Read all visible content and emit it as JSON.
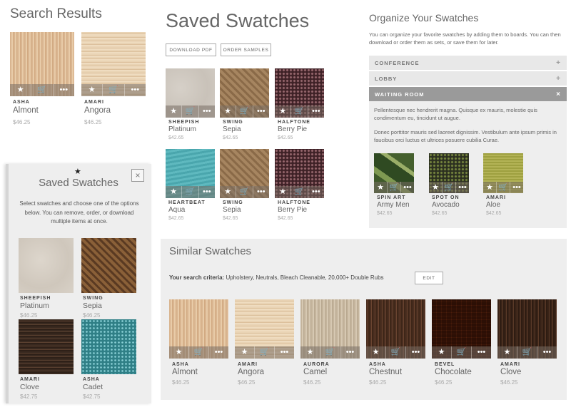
{
  "search_results": {
    "title": "Search Results",
    "items": [
      {
        "brand": "ASHA",
        "name": "Almont",
        "price": "$46.25"
      },
      {
        "brand": "AMARI",
        "name": "Angora",
        "price": "$46.25"
      }
    ]
  },
  "saved_main": {
    "title": "Saved Swatches",
    "download_label": "DOWNLOAD PDF",
    "order_label": "ORDER SAMPLES",
    "items": [
      {
        "brand": "SHEEPISH",
        "name": "Platinum",
        "price": "$42.65"
      },
      {
        "brand": "SWING",
        "name": "Sepia",
        "price": "$42.65"
      },
      {
        "brand": "HALFTONE",
        "name": "Berry Pie",
        "price": "$42.65"
      },
      {
        "brand": "HEARTBEAT",
        "name": "Aqua",
        "price": "$42.65"
      },
      {
        "brand": "SWING",
        "name": "Sepia",
        "price": "$42.65"
      },
      {
        "brand": "HALFTONE",
        "name": "Berry Pie",
        "price": "$42.65"
      }
    ]
  },
  "organize": {
    "title": "Organize Your Swatches",
    "desc": "You can organize your favorite swatches by adding them to boards. You can then download or order them as sets, or save them for later.",
    "boards": [
      {
        "label": "CONFERENCE",
        "icon": "+"
      },
      {
        "label": "LOBBY",
        "icon": "+"
      },
      {
        "label": "WAITING ROOM",
        "icon": "×"
      }
    ],
    "para1": "Pellentesque nec hendrerit magna. Quisque ex mauris, molestie quis condimentum eu, tincidunt ut augue.",
    "para2": "Donec porttitor mauris sed laoreet dignissim. Vestibulum ante ipsum primis in faucibus orci luctus et ultrices posuere cubilia Curae.",
    "items": [
      {
        "brand": "SPIN ART",
        "name": "Army Men",
        "price": "$42.65"
      },
      {
        "brand": "SPOT ON",
        "name": "Avocado",
        "price": "$42.65"
      },
      {
        "brand": "AMARI",
        "name": "Aloe",
        "price": "$42.65"
      }
    ]
  },
  "saved_panel": {
    "star": "★",
    "close": "×",
    "title": "Saved Swatches",
    "desc": "Select swatches and choose one of the options below. You can remove, order, or download multiple items at once.",
    "items": [
      {
        "brand": "SHEEPISH",
        "name": "Platinum",
        "price": "$46.25"
      },
      {
        "brand": "SWING",
        "name": "Sepia",
        "price": "$46.25"
      },
      {
        "brand": "AMARI",
        "name": "Clove",
        "price": "$42.75"
      },
      {
        "brand": "ASHA",
        "name": "Cadet",
        "price": "$42.75"
      }
    ]
  },
  "similar": {
    "title": "Similar Swatches",
    "criteria_label": "Your search criteria:",
    "criteria_value": " Upholstery, Neutrals, Bleach Cleanable, 20,000+ Double Rubs",
    "edit_label": "EDIT",
    "items": [
      {
        "brand": "ASHA",
        "name": "Almont",
        "price": "$46.25"
      },
      {
        "brand": "AMARI",
        "name": "Angora",
        "price": "$46.25"
      },
      {
        "brand": "AURORA",
        "name": "Camel",
        "price": "$46.25"
      },
      {
        "brand": "ASHA",
        "name": "Chestnut",
        "price": "$46.25"
      },
      {
        "brand": "BEVEL",
        "name": "Chocolate",
        "price": "$46.25"
      },
      {
        "brand": "AMARI",
        "name": "Clove",
        "price": "$46.25"
      }
    ]
  },
  "actions": {
    "star": "★",
    "cart": "🛒",
    "more": "•••"
  },
  "colors": {
    "panel_bg": "#eeeeee",
    "accordion_bg": "#e6e6e6",
    "accordion_active": "#9a9a9a",
    "action_bar": "#8a7d70"
  }
}
